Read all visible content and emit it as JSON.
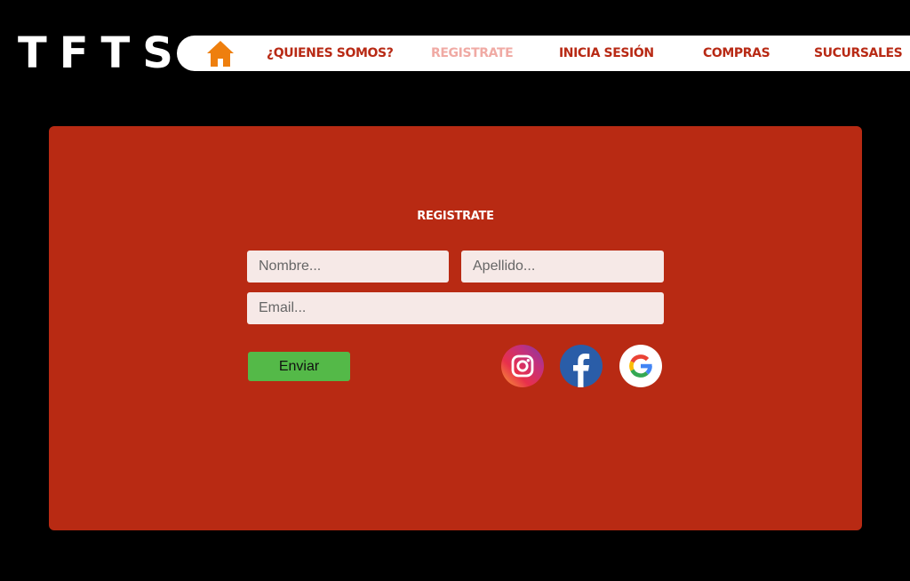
{
  "brand": {
    "logo_text": "TFTS"
  },
  "nav": {
    "home_icon": "home-icon",
    "items": [
      {
        "label": "¿QUIENES SOMOS?",
        "active": false
      },
      {
        "label": "REGISTRATE",
        "active": true
      },
      {
        "label": "INICIA SESIÓN",
        "active": false
      },
      {
        "label": "COMPRAS",
        "active": false
      },
      {
        "label": "SUCURSALES",
        "active": false
      }
    ]
  },
  "form": {
    "title": "REGISTRATE",
    "nombre": {
      "value": "",
      "placeholder": "Nombre..."
    },
    "apellido": {
      "value": "",
      "placeholder": "Apellido..."
    },
    "email": {
      "value": "",
      "placeholder": "Email..."
    },
    "submit_label": "Enviar",
    "social": [
      "instagram-icon",
      "facebook-icon",
      "google-icon"
    ]
  },
  "colors": {
    "background": "#000000",
    "panel": "#b82a13",
    "nav_text": "#b82a15",
    "nav_active_text": "#f0aaa4",
    "home_icon": "#ee7f0e",
    "submit_button": "#54b948"
  }
}
